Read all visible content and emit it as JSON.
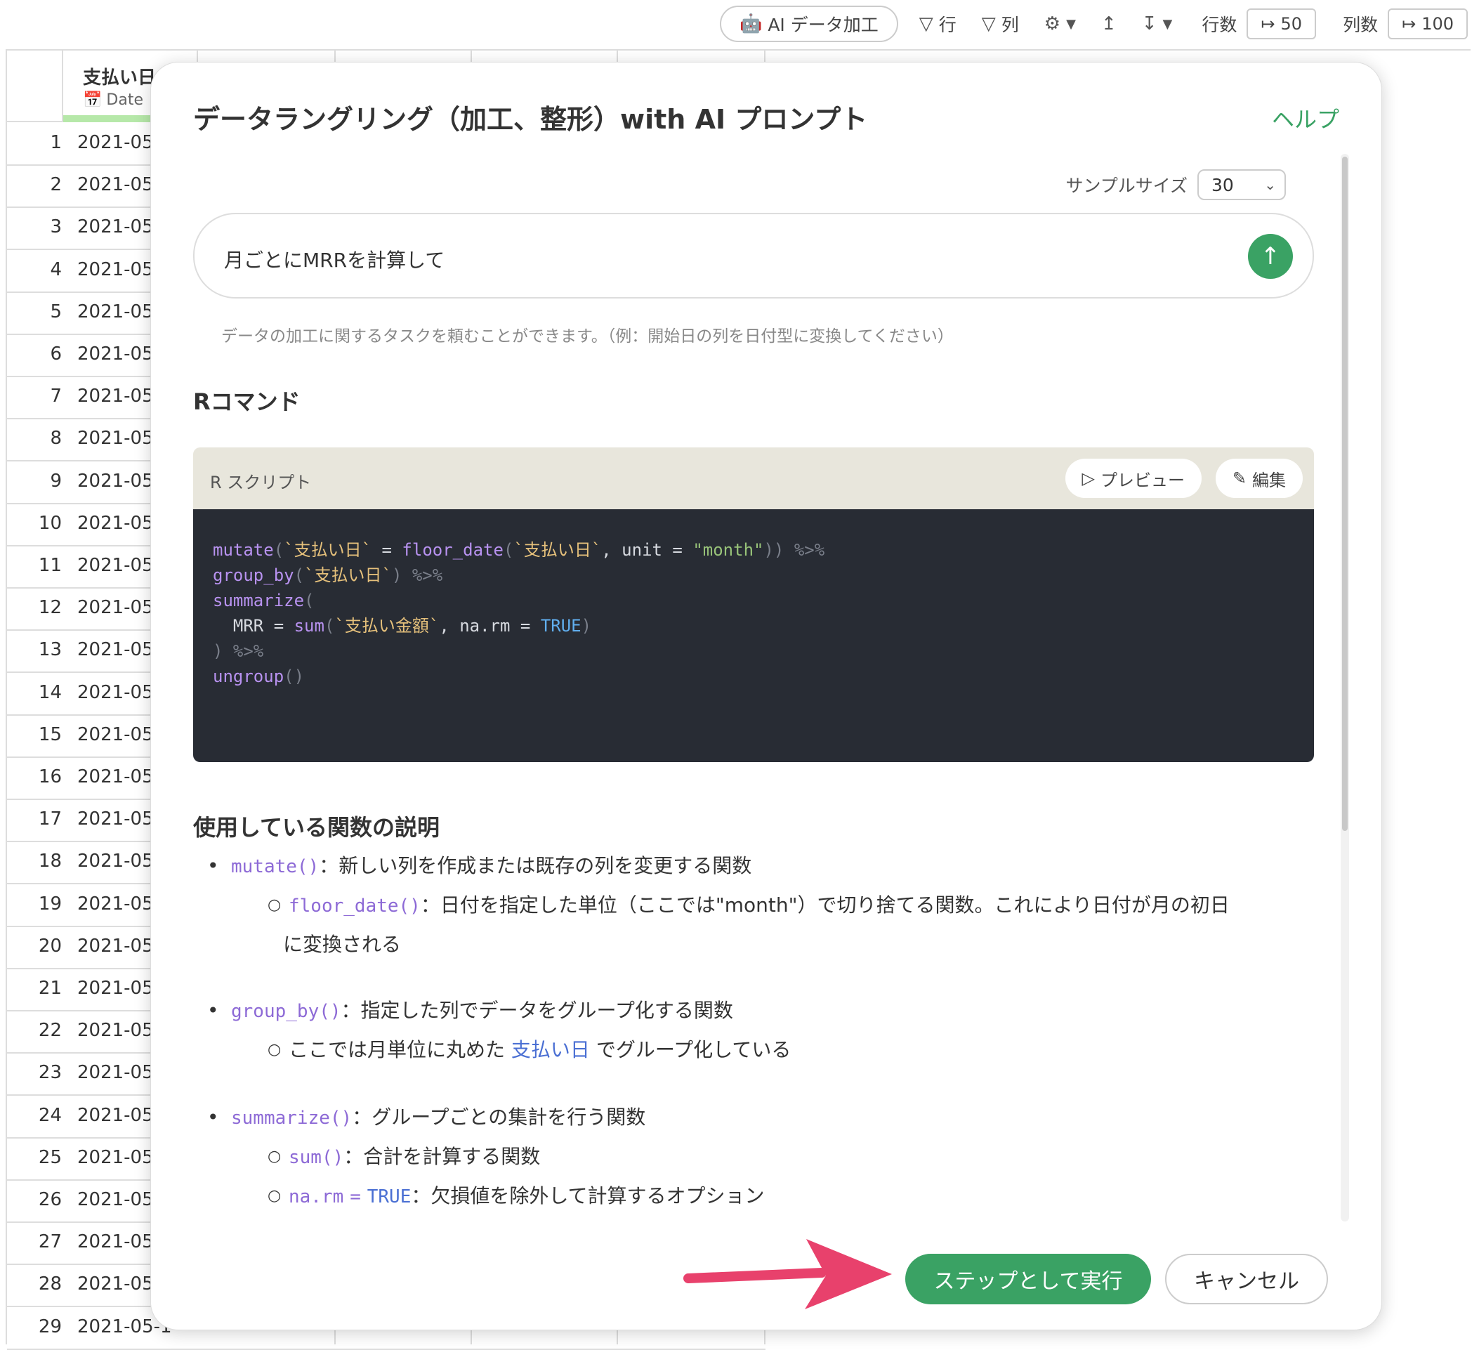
{
  "toolbar": {
    "ai_button": "AI データ加工",
    "row_filter": "行",
    "col_filter": "列",
    "rows_label": "行数",
    "rows_value": "50",
    "cols_label": "列数",
    "cols_value": "100"
  },
  "grid": {
    "column_name": "支払い日",
    "column_type": "Date",
    "date_prefix": "2021-05",
    "last_date_prefix": "2021-05-1",
    "rows": [
      "1",
      "2",
      "3",
      "4",
      "5",
      "6",
      "7",
      "8",
      "9",
      "10",
      "11",
      "12",
      "13",
      "14",
      "15",
      "16",
      "17",
      "18",
      "19",
      "20",
      "21",
      "22",
      "23",
      "24",
      "25",
      "26",
      "27",
      "28",
      "29"
    ]
  },
  "modal": {
    "title": "データラングリング（加工、整形）with AI プロンプト",
    "help": "ヘルプ",
    "sample_label": "サンプルサイズ",
    "sample_value": "30",
    "prompt_value": "月ごとにMRRを計算して",
    "prompt_hint": "データの加工に関するタスクを頼むことができます。（例：開始日の列を日付型に変換してください）",
    "rcmd_heading": "Rコマンド",
    "script_label": "R スクリプト",
    "preview_button": "プレビュー",
    "edit_button": "編集",
    "func_heading": "使用している関数の説明",
    "explanations": {
      "mutate_code": "mutate()",
      "mutate_text": "：新しい列を作成または既存の列を変更する関数",
      "floor_code": "floor_date()",
      "floor_text": "：日付を指定した単位（ここでは\"month\"）で切り捨てる関数。これにより日付が月の初日",
      "floor_text2": "に変換される",
      "groupby_code": "group_by()",
      "groupby_text": "：指定した列でデータをグループ化する関数",
      "groupby_sub_pre": "ここでは月単位に丸めた",
      "groupby_sub_hl": "支払い日",
      "groupby_sub_post": "でグループ化している",
      "summarize_code": "summarize()",
      "summarize_text": "：グループごとの集計を行う関数",
      "sum_code": "sum()",
      "sum_text": "：合計を計算する関数",
      "narm_code1": "na.rm",
      "narm_code2": "=",
      "narm_code3": "TRUE",
      "narm_text": "：欠損値を除外して計算するオプション"
    },
    "run_button": "ステップとして実行",
    "cancel_button": "キャンセル"
  },
  "code": {
    "l1_fn": "mutate",
    "l1_open": "(",
    "l1_col": "`支払い日`",
    "l1_eq": " = ",
    "l1_fn2": "floor_date",
    "l1_open2": "(",
    "l1_col2": "`支払い日`",
    "l1_unit": ", unit = ",
    "l1_month": "\"month\"",
    "l1_close": "))",
    "l1_pipe": " %>%",
    "l2_fn": "group_by",
    "l2_open": "(",
    "l2_col": "`支払い日`",
    "l2_close": ")",
    "l2_pipe": " %>%",
    "l3_fn": "summarize",
    "l3_open": "(",
    "l4_indent": "  MRR = ",
    "l4_fn": "sum",
    "l4_open": "(",
    "l4_col": "`支払い金額`",
    "l4_narm": ", na.rm = ",
    "l4_true": "TRUE",
    "l4_close": ")",
    "l5_close": ")",
    "l5_pipe": " %>%",
    "l6_fn": "ungroup",
    "l6_paren": "()"
  },
  "colors": {
    "accent": "#3aa264",
    "arrow": "#e8416c",
    "code_bg": "#282c34"
  }
}
